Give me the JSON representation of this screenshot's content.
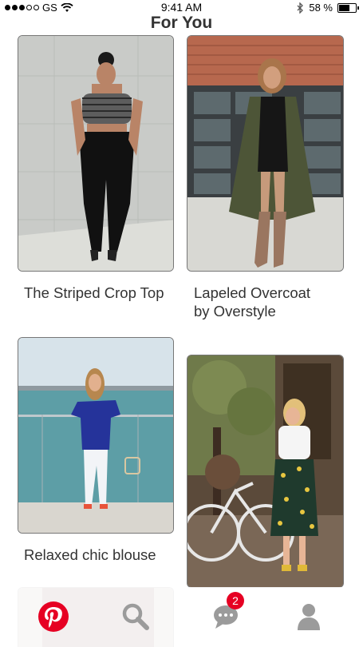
{
  "status_bar": {
    "carrier": "GS",
    "time": "9:41 AM",
    "battery": "58 %",
    "battery_level": 0.58,
    "signal_bars_filled": 3,
    "signal_bars_total": 5,
    "icons": [
      "signal-dots-icon",
      "wifi-icon",
      "bluetooth-icon",
      "battery-icon"
    ]
  },
  "header": {
    "title": "For You"
  },
  "pins": [
    {
      "title": "The Striped Crop Top",
      "image": "woman-striped-crop-top-photo"
    },
    {
      "title": "Lapeled Overcoat by Overstyle",
      "title_line1": "Lapeled Overcoat",
      "title_line2": "by Overstyle",
      "image": "woman-olive-overcoat-photo"
    },
    {
      "title": "Relaxed chic blouse",
      "image": "woman-blue-blouse-lakeside-photo"
    },
    {
      "title": "",
      "image": "woman-lemon-skirt-bicycle-photo"
    },
    {
      "title": "",
      "image": "partial-pin-photo"
    }
  ],
  "bottom_nav": {
    "items": [
      "pinterest-logo-icon",
      "search-icon",
      "messages-icon",
      "profile-icon"
    ],
    "messages_badge": "2",
    "accent_color": "#e60023",
    "icon_color": "#9b9b9b"
  }
}
